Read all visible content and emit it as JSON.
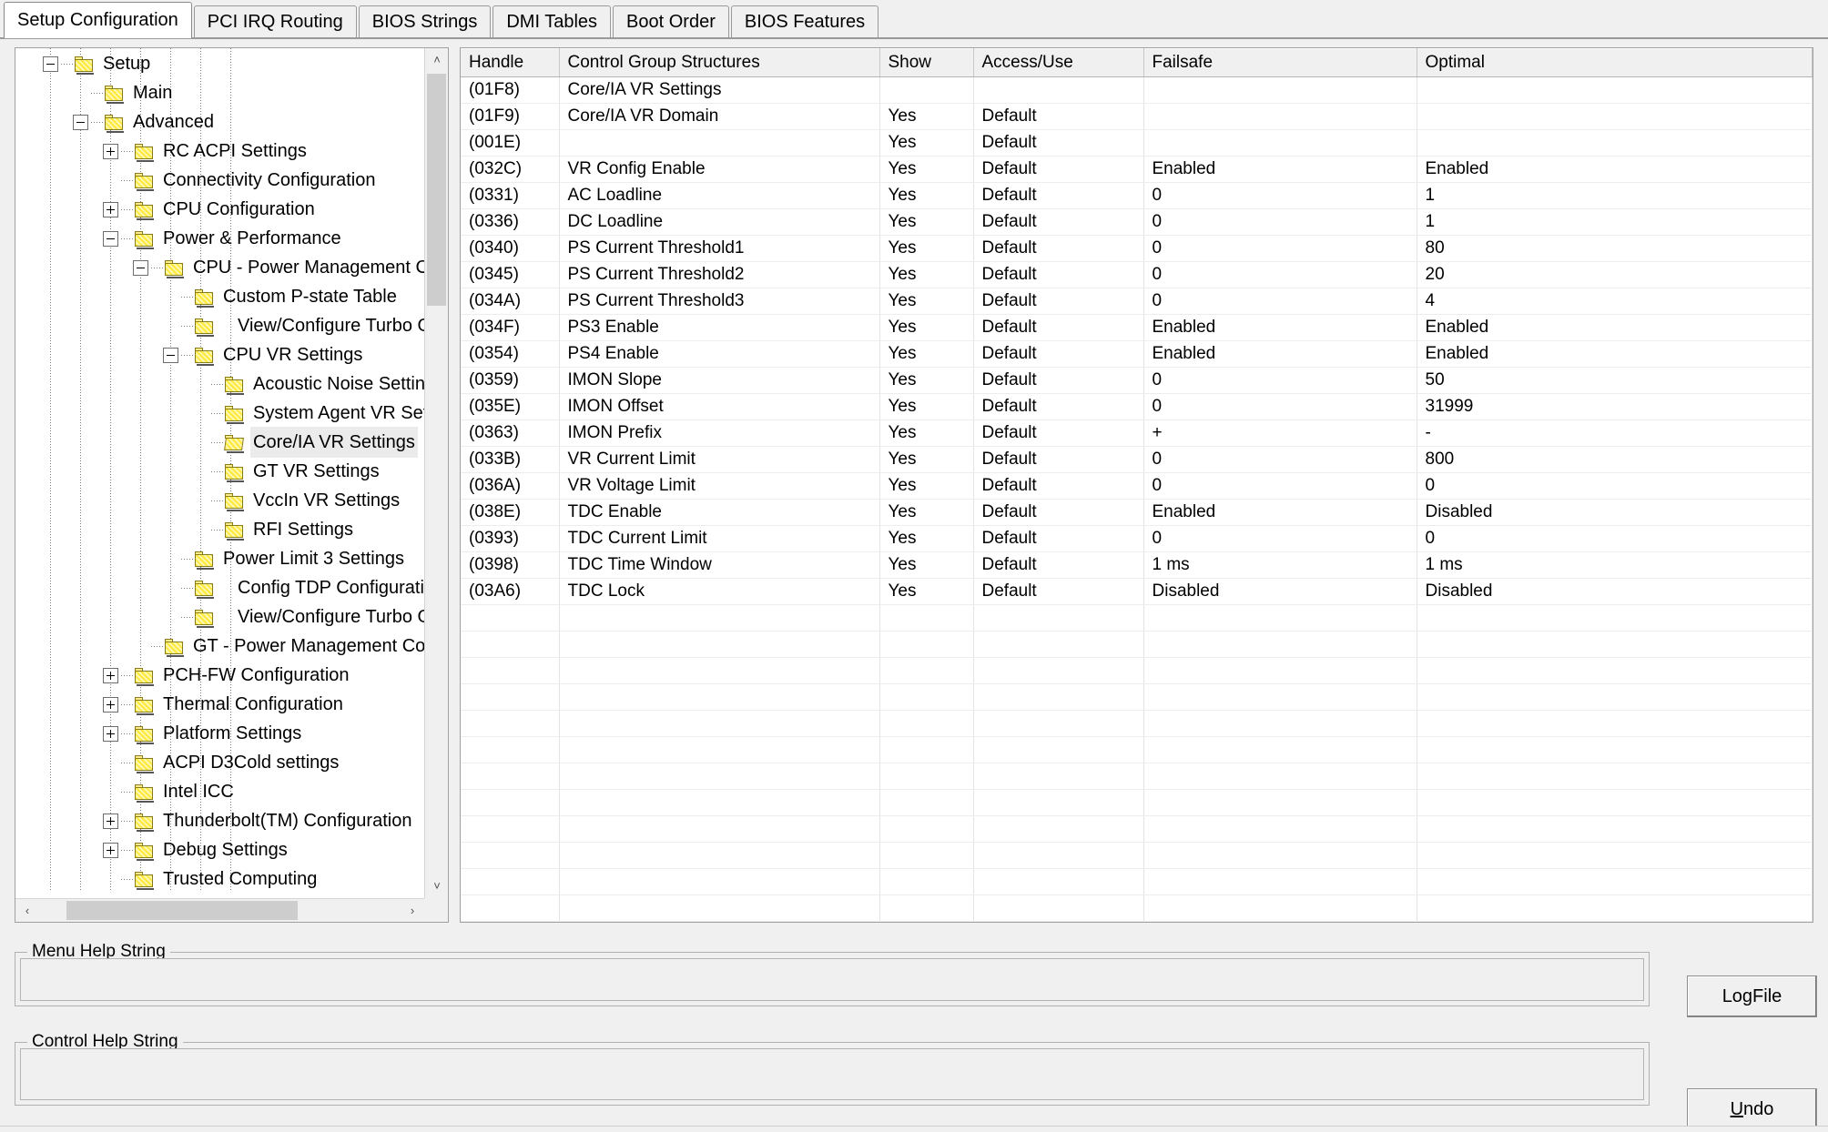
{
  "window": {
    "tabs": [
      {
        "label": "Setup Configuration",
        "selected": true
      },
      {
        "label": "PCI IRQ Routing",
        "selected": false
      },
      {
        "label": "BIOS Strings",
        "selected": false
      },
      {
        "label": "DMI Tables",
        "selected": false
      },
      {
        "label": "Boot Order",
        "selected": false
      },
      {
        "label": "BIOS Features",
        "selected": false
      }
    ]
  },
  "tree": {
    "nodes": [
      {
        "label": "Setup",
        "depth": 1,
        "toggle": "minus",
        "selected": false
      },
      {
        "label": "Main",
        "depth": 2,
        "toggle": "none",
        "selected": false
      },
      {
        "label": "Advanced",
        "depth": 2,
        "toggle": "minus",
        "selected": false
      },
      {
        "label": "RC ACPI Settings",
        "depth": 3,
        "toggle": "plus",
        "selected": false
      },
      {
        "label": "Connectivity Configuration",
        "depth": 3,
        "toggle": "none",
        "selected": false
      },
      {
        "label": "CPU Configuration",
        "depth": 3,
        "toggle": "plus",
        "selected": false
      },
      {
        "label": "Power & Performance",
        "depth": 3,
        "toggle": "minus",
        "selected": false
      },
      {
        "label": "CPU - Power Management Control",
        "depth": 4,
        "toggle": "minus",
        "selected": false
      },
      {
        "label": "Custom P-state Table",
        "depth": 5,
        "toggle": "none",
        "selected": false
      },
      {
        "label": "View/Configure Turbo Options",
        "depth": 5,
        "toggle": "none",
        "selected": false,
        "extraindent": true
      },
      {
        "label": "CPU VR Settings",
        "depth": 5,
        "toggle": "minus",
        "selected": false
      },
      {
        "label": "Acoustic Noise Settings",
        "depth": 6,
        "toggle": "none",
        "selected": false
      },
      {
        "label": "System Agent VR Settings",
        "depth": 6,
        "toggle": "none",
        "selected": false
      },
      {
        "label": "Core/IA VR Settings",
        "depth": 6,
        "toggle": "none",
        "selected": true,
        "openfolder": true
      },
      {
        "label": "GT VR Settings",
        "depth": 6,
        "toggle": "none",
        "selected": false
      },
      {
        "label": "VccIn VR Settings",
        "depth": 6,
        "toggle": "none",
        "selected": false
      },
      {
        "label": "RFI Settings",
        "depth": 6,
        "toggle": "none",
        "selected": false
      },
      {
        "label": "Power Limit 3 Settings",
        "depth": 5,
        "toggle": "none",
        "selected": false
      },
      {
        "label": "Config TDP Configurations",
        "depth": 5,
        "toggle": "none",
        "selected": false,
        "extraindent": true
      },
      {
        "label": "View/Configure Turbo Options",
        "depth": 5,
        "toggle": "none",
        "selected": false,
        "extraindent": true
      },
      {
        "label": "GT - Power Management Control",
        "depth": 4,
        "toggle": "none",
        "selected": false
      },
      {
        "label": "PCH-FW Configuration",
        "depth": 3,
        "toggle": "plus",
        "selected": false
      },
      {
        "label": "Thermal Configuration",
        "depth": 3,
        "toggle": "plus",
        "selected": false
      },
      {
        "label": "Platform Settings",
        "depth": 3,
        "toggle": "plus",
        "selected": false
      },
      {
        "label": "ACPI D3Cold settings",
        "depth": 3,
        "toggle": "none",
        "selected": false
      },
      {
        "label": "Intel ICC",
        "depth": 3,
        "toggle": "none",
        "selected": false
      },
      {
        "label": "Thunderbolt(TM) Configuration",
        "depth": 3,
        "toggle": "plus",
        "selected": false
      },
      {
        "label": "Debug Settings",
        "depth": 3,
        "toggle": "plus",
        "selected": false
      },
      {
        "label": "Trusted Computing",
        "depth": 3,
        "toggle": "none",
        "selected": false
      }
    ],
    "scroll_up_icon": "˄",
    "scroll_down_icon": "˅",
    "scroll_left_icon": "‹",
    "scroll_right_icon": "›"
  },
  "grid": {
    "columns": [
      "Handle",
      "Control Group Structures",
      "Show",
      "Access/Use",
      "Failsafe",
      "Optimal"
    ],
    "rows": [
      {
        "handle": "(01F8)",
        "name": "Core/IA VR Settings",
        "indent": 0,
        "show": "",
        "access": "",
        "failsafe": "",
        "optimal": ""
      },
      {
        "handle": "(01F9)",
        "name": "Core/IA VR Domain",
        "indent": 0,
        "show": "Yes",
        "access": "Default",
        "failsafe": "",
        "optimal": ""
      },
      {
        "handle": "(001E)",
        "name": "",
        "indent": 0,
        "show": "Yes",
        "access": "Default",
        "failsafe": "",
        "optimal": ""
      },
      {
        "handle": "(032C)",
        "name": "VR Config Enable",
        "indent": 0,
        "show": "Yes",
        "access": "Default",
        "failsafe": "Enabled",
        "optimal": "Enabled"
      },
      {
        "handle": "(0331)",
        "name": "AC Loadline",
        "indent": 0,
        "show": "Yes",
        "access": "Default",
        "failsafe": "0",
        "optimal": "1"
      },
      {
        "handle": "(0336)",
        "name": "DC Loadline",
        "indent": 0,
        "show": "Yes",
        "access": "Default",
        "failsafe": "0",
        "optimal": "1"
      },
      {
        "handle": "(0340)",
        "name": "PS Current Threshold1",
        "indent": 0,
        "show": "Yes",
        "access": "Default",
        "failsafe": "0",
        "optimal": "80"
      },
      {
        "handle": "(0345)",
        "name": "PS Current Threshold2",
        "indent": 0,
        "show": "Yes",
        "access": "Default",
        "failsafe": "0",
        "optimal": "20"
      },
      {
        "handle": "(034A)",
        "name": "PS Current Threshold3",
        "indent": 0,
        "show": "Yes",
        "access": "Default",
        "failsafe": "0",
        "optimal": "4"
      },
      {
        "handle": "(034F)",
        "name": "PS3 Enable",
        "indent": 0,
        "show": "Yes",
        "access": "Default",
        "failsafe": "Enabled",
        "optimal": "Enabled"
      },
      {
        "handle": "(0354)",
        "name": "PS4 Enable",
        "indent": 0,
        "show": "Yes",
        "access": "Default",
        "failsafe": "Enabled",
        "optimal": "Enabled"
      },
      {
        "handle": "(0359)",
        "name": "IMON Slope",
        "indent": 0,
        "show": "Yes",
        "access": "Default",
        "failsafe": "0",
        "optimal": "50"
      },
      {
        "handle": "(035E)",
        "name": "IMON Offset",
        "indent": 0,
        "show": "Yes",
        "access": "Default",
        "failsafe": "0",
        "optimal": "31999"
      },
      {
        "handle": "(0363)",
        "name": "IMON Prefix",
        "indent": 1,
        "show": "Yes",
        "access": "Default",
        "failsafe": "+",
        "optimal": "-"
      },
      {
        "handle": "(033B)",
        "name": "VR Current Limit",
        "indent": 0,
        "show": "Yes",
        "access": "Default",
        "failsafe": "0",
        "optimal": "800"
      },
      {
        "handle": "(036A)",
        "name": "VR Voltage Limit",
        "indent": 0,
        "show": "Yes",
        "access": "Default",
        "failsafe": "0",
        "optimal": "0"
      },
      {
        "handle": "(038E)",
        "name": "TDC Enable",
        "indent": 0,
        "show": "Yes",
        "access": "Default",
        "failsafe": "Enabled",
        "optimal": "Disabled"
      },
      {
        "handle": "(0393)",
        "name": "TDC Current Limit",
        "indent": 0,
        "show": "Yes",
        "access": "Default",
        "failsafe": "0",
        "optimal": "0"
      },
      {
        "handle": "(0398)",
        "name": "TDC Time Window",
        "indent": 0,
        "show": "Yes",
        "access": "Default",
        "failsafe": "1 ms",
        "optimal": "1 ms"
      },
      {
        "handle": "(03A6)",
        "name": "TDC Lock",
        "indent": 0,
        "show": "Yes",
        "access": "Default",
        "failsafe": "Disabled",
        "optimal": "Disabled"
      }
    ]
  },
  "help": {
    "menu_help_title": "Menu Help String",
    "menu_help_value": "",
    "control_help_title": "Control Help String",
    "control_help_value": ""
  },
  "buttons": {
    "logfile": "LogFile",
    "undo_prefix": "U",
    "undo_rest": "ndo"
  }
}
